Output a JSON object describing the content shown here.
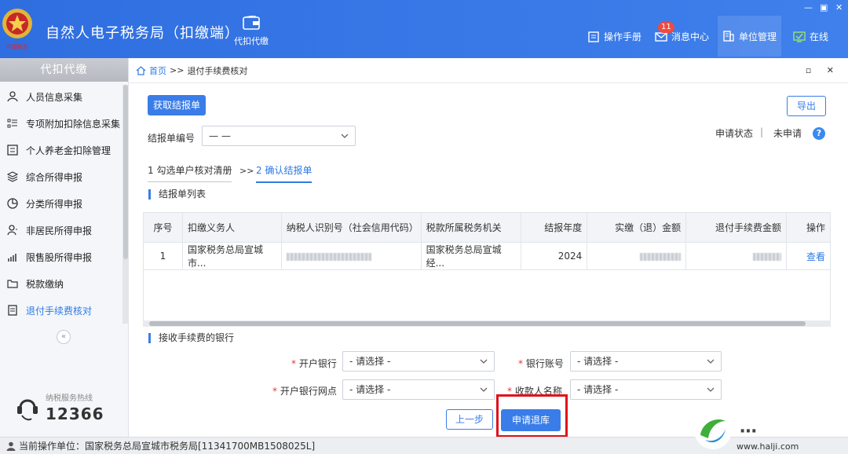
{
  "header": {
    "app_title": "自然人电子税务局（扣缴端）",
    "emblem_text": "中国税务",
    "nav_main_label": "代扣代缴",
    "links": [
      {
        "label": "操作手册",
        "icon": "book-icon"
      },
      {
        "label": "消息中心",
        "icon": "mail-icon",
        "badge": "11"
      },
      {
        "label": "单位管理",
        "icon": "building-icon"
      },
      {
        "label": "在线",
        "icon": "online-check-icon"
      }
    ],
    "window_controls": [
      "—",
      "▣",
      "✕"
    ]
  },
  "sidebar": {
    "title": "代扣代缴",
    "items": [
      {
        "label": "人员信息采集",
        "icon": "person-icon"
      },
      {
        "label": "专项附加扣除信息采集",
        "icon": "list-icon"
      },
      {
        "label": "个人养老金扣除管理",
        "icon": "pension-card-icon"
      },
      {
        "label": "综合所得申报",
        "icon": "layers-icon"
      },
      {
        "label": "分类所得申报",
        "icon": "pie-chart-icon"
      },
      {
        "label": "非居民所得申报",
        "icon": "person-outline-icon"
      },
      {
        "label": "限售股所得申报",
        "icon": "bar-chart-icon"
      },
      {
        "label": "税款缴纳",
        "icon": "folder-icon"
      },
      {
        "label": "退付手续费核对",
        "icon": "document-icon",
        "active": true
      }
    ],
    "collapse_symbol": "«",
    "hotline_label": "纳税服务热线",
    "hotline_number": "12366"
  },
  "breadcrumb": {
    "home": "首页",
    "separator": ">>",
    "current": "退付手续费核对",
    "controls": "▫ ✕"
  },
  "toolbar": {
    "fetch_button": "获取结报单",
    "export_button": "导出"
  },
  "form": {
    "report_no_label": "结报单编号",
    "report_no_value": "— —",
    "status_label": "申请状态",
    "status_separator": "|",
    "status_value": "未申请",
    "help": "?"
  },
  "steps": {
    "step1": "1 勾选单户核对清册",
    "arrow": ">>",
    "step2": "2 确认结报单"
  },
  "report_list": {
    "title": "结报单列表",
    "columns": [
      "序号",
      "扣缴义务人",
      "纳税人识别号（社会信用代码）",
      "税款所属税务机关",
      "结报年度",
      "实缴（退）金额",
      "退付手续费金额",
      "操作"
    ],
    "rows": [
      {
        "index": "1",
        "withholder": "国家税务总局宣城市...",
        "tax_authority": "国家税务总局宣城经...",
        "year": "2024",
        "action": "查看"
      }
    ]
  },
  "bank": {
    "title": "接收手续费的银行",
    "required_mark": "*",
    "bank_label": "开户银行",
    "bank_value": "- 请选择 -",
    "account_label": "银行账号",
    "account_value": "- 请选择 -",
    "branch_label": "开户银行网点",
    "branch_value": "- 请选择 -",
    "payee_label": "收款人名称",
    "payee_value": "- 请选择 -"
  },
  "actions": {
    "prev_button": "上一步",
    "submit_button": "申请退库"
  },
  "status_bar": {
    "text": "当前操作单位：国家税务总局宣城市税务局[11341700MB1508025L]"
  },
  "watermark": {
    "text": "www.halji.com"
  }
}
